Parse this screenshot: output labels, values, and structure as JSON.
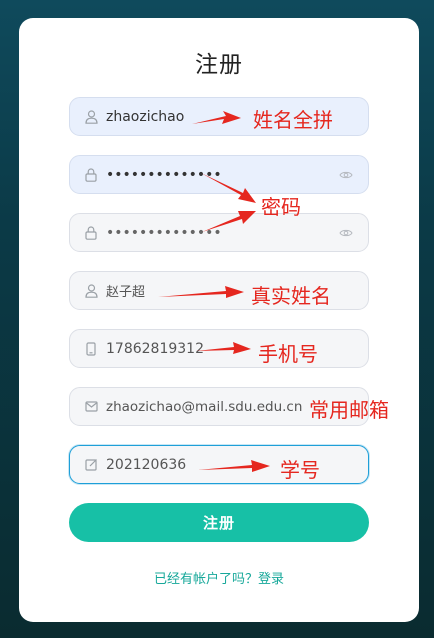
{
  "form": {
    "title": "注册",
    "submit_label": "注册",
    "login_link": "已经有帐户了吗？登录",
    "fields": {
      "username": {
        "value": "zhaozichao",
        "icon": "user-icon"
      },
      "password": {
        "value": "••••••••••••••",
        "icon": "lock-icon"
      },
      "confirm_password": {
        "value": "••••••••••••••",
        "icon": "lock-icon"
      },
      "real_name": {
        "value": "赵子超",
        "icon": "user-icon"
      },
      "phone": {
        "value": "17862819312",
        "icon": "phone-icon"
      },
      "email": {
        "value": "zhaozichao@mail.sdu.edu.cn",
        "icon": "mail-icon"
      },
      "student_id": {
        "value": "202120636",
        "icon": "edit-icon"
      }
    }
  },
  "annotations": {
    "username": "姓名全拼",
    "password": "密码",
    "real_name": "真实姓名",
    "phone": "手机号",
    "email": "常用邮箱",
    "student_id": "学号"
  },
  "colors": {
    "accent": "#17c0a6",
    "annotation": "#e5271f",
    "link": "#17a89a",
    "focus_border": "#1e9fd8"
  }
}
